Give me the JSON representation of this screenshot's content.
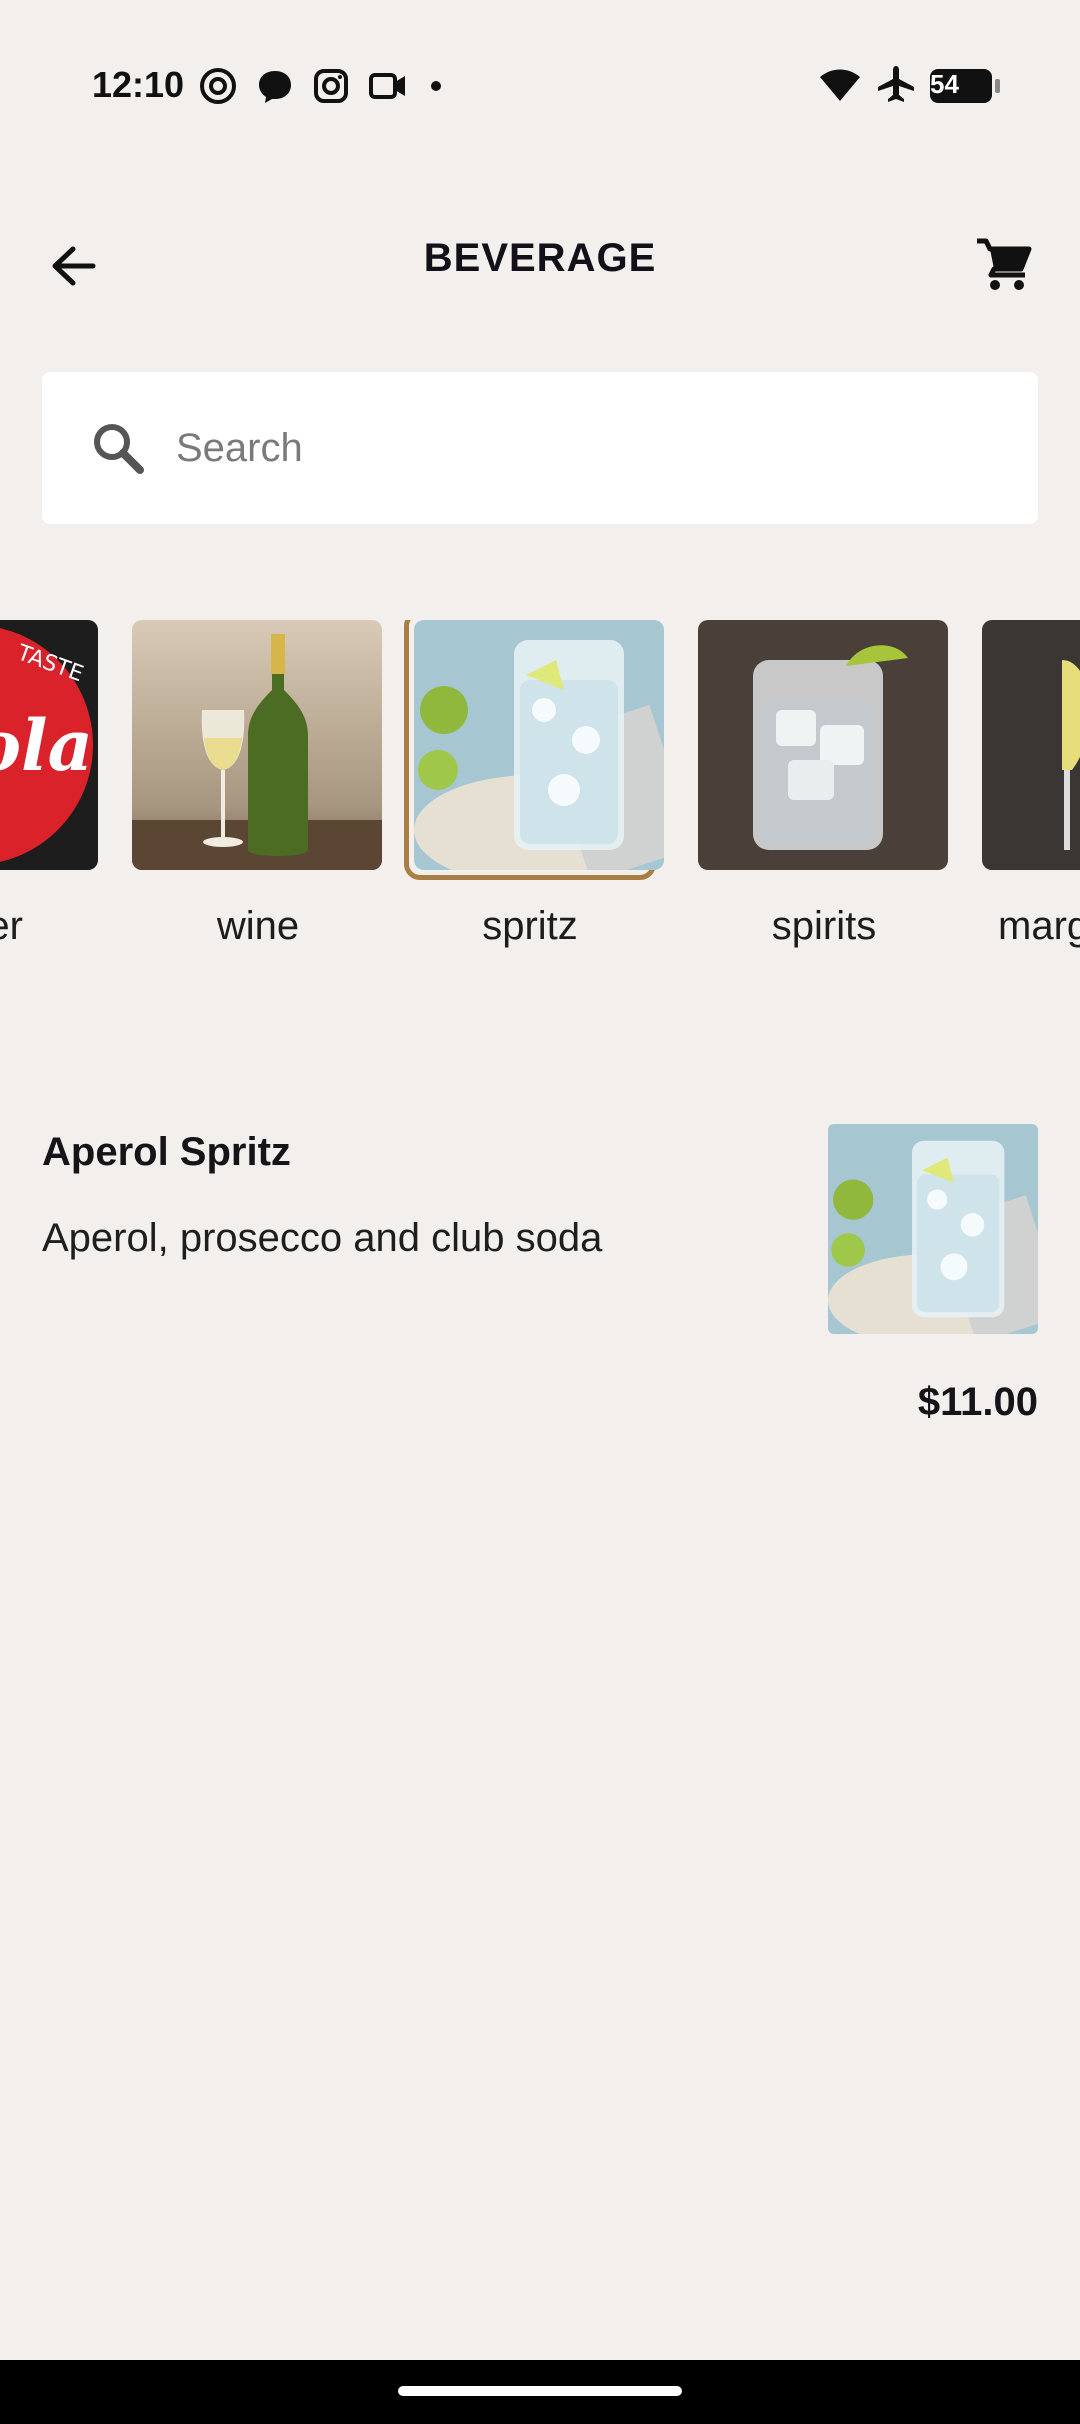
{
  "status_bar": {
    "time": "12:10",
    "left_icons": [
      "threads-icon",
      "messenger-icon",
      "instagram-icon",
      "video-icon",
      "dot-icon"
    ],
    "right_icons": [
      "wifi-icon",
      "airplane-icon"
    ],
    "battery": "54"
  },
  "header": {
    "title": "BEVERAGE",
    "back_icon": "arrow-left-icon",
    "cart_icon": "cart-icon"
  },
  "search": {
    "placeholder": "Search",
    "value": ""
  },
  "categories": [
    {
      "label": "water",
      "image": "coca-cola-logo",
      "selected": false
    },
    {
      "label": "wine",
      "image": "white-wine-bottle-glass",
      "selected": false
    },
    {
      "label": "spritz",
      "image": "spritz-glass-with-lime",
      "selected": true
    },
    {
      "label": "spirits",
      "image": "spirits-glass-with-lime",
      "selected": false
    },
    {
      "label": "marg",
      "image": "margarita-glass",
      "selected": false
    }
  ],
  "menu_items": [
    {
      "name": "Aperol Spritz",
      "description": "Aperol, prosecco and club soda",
      "price": "$11.00",
      "image": "spritz-glass-with-lime"
    }
  ],
  "colors": {
    "background": "#f2efec",
    "accent_border": "#a97e44",
    "text": "#161418"
  }
}
